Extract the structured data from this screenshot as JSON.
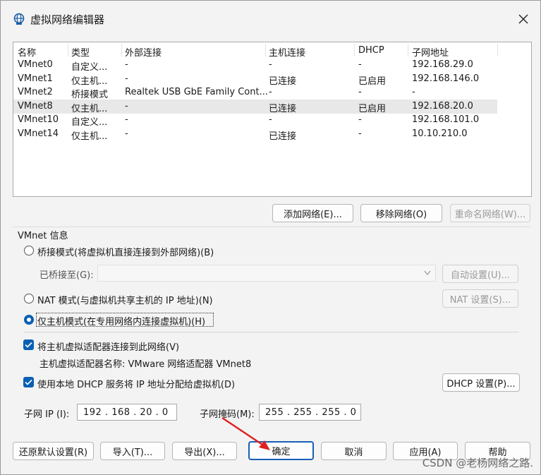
{
  "window": {
    "title": "虚拟网络编辑器",
    "close_glyph": "✕"
  },
  "network_list": {
    "columns": [
      "名称",
      "类型",
      "外部连接",
      "主机连接",
      "DHCP",
      "子网地址"
    ],
    "rows": [
      [
        "VMnet0",
        "自定义...",
        "-",
        "-",
        "-",
        "192.168.29.0"
      ],
      [
        "VMnet1",
        "仅主机...",
        "-",
        "已连接",
        "已启用",
        "192.168.146.0"
      ],
      [
        "VMnet2",
        "桥接模式",
        "Realtek USB GbE Family Cont...",
        "-",
        "-",
        "-"
      ],
      [
        "VMnet8",
        "仅主机...",
        "-",
        "已连接",
        "已启用",
        "192.168.20.0"
      ],
      [
        "VMnet10",
        "自定义...",
        "-",
        "-",
        "-",
        "192.168.101.0"
      ],
      [
        "VMnet14",
        "仅主机...",
        "-",
        "已连接",
        "-",
        "10.10.210.0"
      ]
    ],
    "selected_row": 3
  },
  "list_buttons": {
    "add": "添加网络(E)...",
    "remove": "移除网络(O)",
    "rename": "重命名网络(W)..."
  },
  "vmnet_info": {
    "group_title": "VMnet 信息",
    "bridged_label": "桥接模式(将虚拟机直接连接到外部网络)(B)",
    "bridged_to_label": "已桥接至(G):",
    "auto_settings": "自动设置(U)...",
    "nat_label": "NAT 模式(与虚拟机共享主机的 IP 地址)(N)",
    "nat_settings": "NAT 设置(S)...",
    "hostonly_label": "仅主机模式(在专用网络内连接虚拟机)(H)",
    "connect_adapter_label": "将主机虚拟适配器连接到此网络(V)",
    "adapter_name_label": "主机虚拟适配器名称: VMware 网络适配器 VMnet8",
    "dhcp_label": "使用本地 DHCP 服务将 IP 地址分配给虚拟机(D)",
    "dhcp_settings": "DHCP 设置(P)...",
    "subnet_ip_label": "子网 IP (I):",
    "subnet_ip": "192 . 168 . 20 . 0",
    "subnet_mask_label": "子网掩码(M):",
    "subnet_mask": "255 . 255 . 255 . 0",
    "selected_mode": "hostonly"
  },
  "footer_buttons": {
    "restore": "还原默认设置(R)",
    "import": "导入(T)...",
    "export": "导出(X)...",
    "ok": "确定",
    "cancel": "取消",
    "apply": "应用(A)",
    "help": "帮助"
  },
  "watermark": "CSDN @老杨网络之路.",
  "colors": {
    "accent": "#0a5fb4",
    "arrow": "#e02020"
  }
}
